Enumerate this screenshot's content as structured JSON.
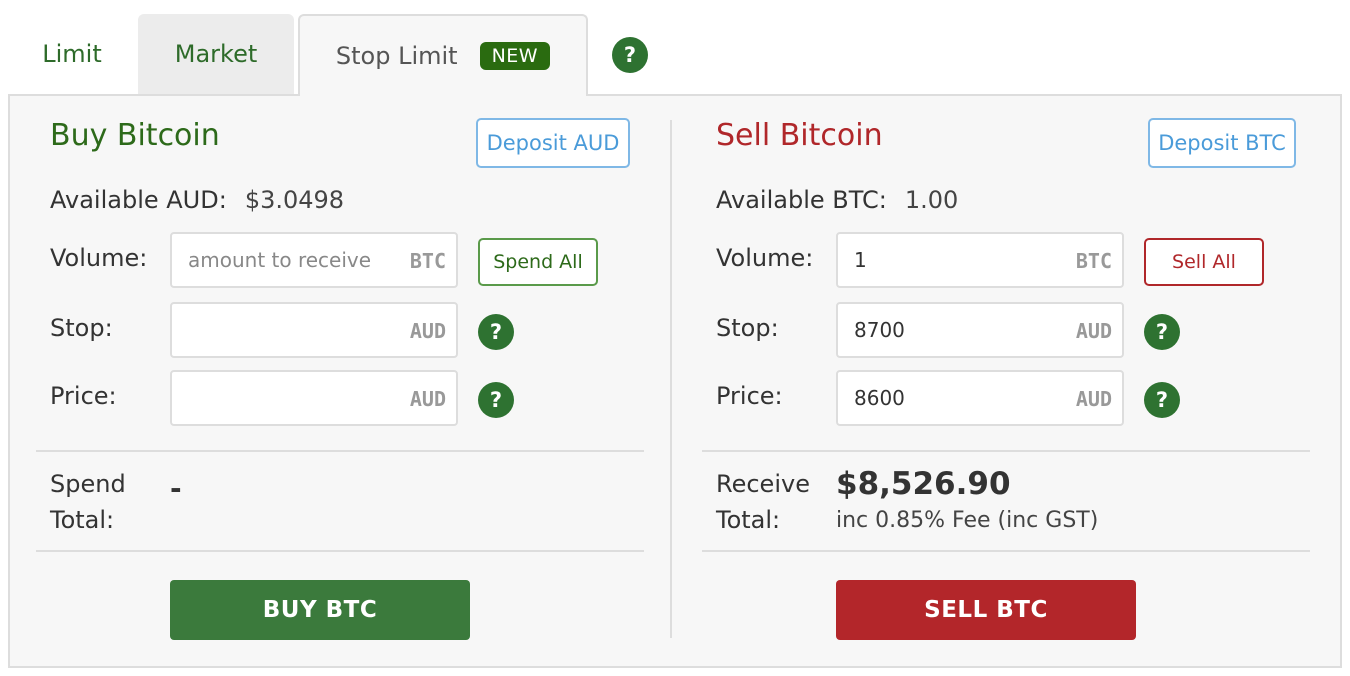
{
  "tabs": {
    "limit": "Limit",
    "market": "Market",
    "stop_limit": "Stop Limit",
    "new_badge": "NEW",
    "help_glyph": "?"
  },
  "buy": {
    "title": "Buy Bitcoin",
    "deposit_button": "Deposit AUD",
    "available_label": "Available AUD:",
    "available_value": "$3.0498",
    "volume_label": "Volume:",
    "volume_placeholder": "amount to receive",
    "volume_value": "",
    "volume_unit": "BTC",
    "spend_all_button": "Spend All",
    "stop_label": "Stop:",
    "stop_value": "",
    "stop_unit": "AUD",
    "price_label": "Price:",
    "price_value": "",
    "price_unit": "AUD",
    "total_label_line1": "Spend",
    "total_label_line2": "Total:",
    "total_value": "-",
    "action_button": "BUY BTC",
    "help_glyph": "?"
  },
  "sell": {
    "title": "Sell Bitcoin",
    "deposit_button": "Deposit BTC",
    "available_label": "Available BTC:",
    "available_value": "1.00",
    "volume_label": "Volume:",
    "volume_value": "1",
    "volume_unit": "BTC",
    "sell_all_button": "Sell All",
    "stop_label": "Stop:",
    "stop_value": "8700",
    "stop_unit": "AUD",
    "price_label": "Price:",
    "price_value": "8600",
    "price_unit": "AUD",
    "total_label_line1": "Receive",
    "total_label_line2": "Total:",
    "total_value": "$8,526.90",
    "fee_note": "inc 0.85% Fee (inc GST)",
    "action_button": "SELL BTC",
    "help_glyph": "?"
  },
  "colors": {
    "buy_green": "#3b7a3c",
    "sell_red": "#b3262a",
    "deposit_blue": "#4a9bd9",
    "help_green": "#2e7231"
  },
  "icons": {
    "help": "question-circle-icon"
  }
}
